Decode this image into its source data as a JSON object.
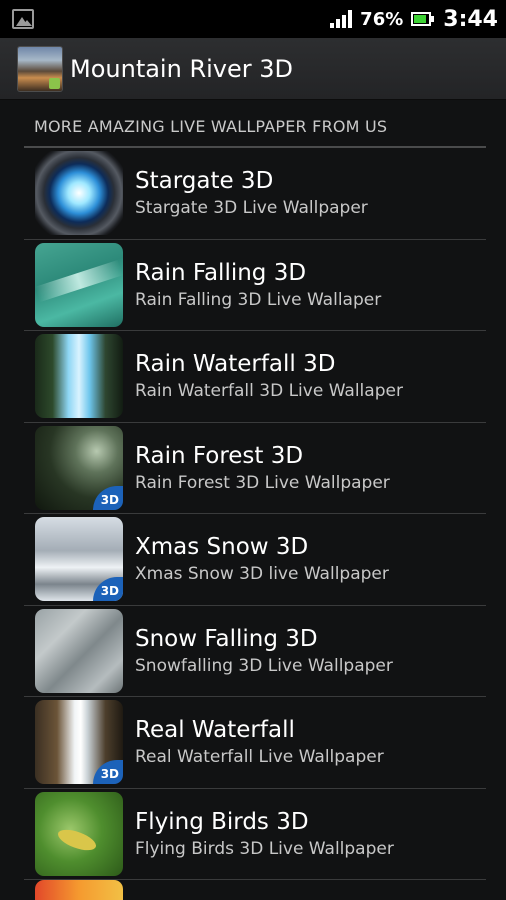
{
  "status_bar": {
    "battery_percent": "76%",
    "time": "3:44",
    "signal_bars": 4,
    "icons": [
      "gallery-icon",
      "signal-icon",
      "battery-icon"
    ]
  },
  "action_bar": {
    "title": "Mountain River 3D",
    "icon": "app-icon"
  },
  "section": {
    "header": "MORE AMAZING LIVE WALLPAPER FROM US"
  },
  "items": [
    {
      "title": "Stargate 3D",
      "subtitle": "Stargate 3D Live Wallpaper",
      "badge": ""
    },
    {
      "title": "Rain Falling 3D",
      "subtitle": "Rain Falling 3D Live Wallaper",
      "badge": ""
    },
    {
      "title": "Rain Waterfall 3D",
      "subtitle": "Rain Waterfall 3D Live Wallaper",
      "badge": ""
    },
    {
      "title": "Rain Forest 3D",
      "subtitle": "Rain Forest 3D Live Wallpaper",
      "badge": "3D"
    },
    {
      "title": "Xmas Snow 3D",
      "subtitle": "Xmas Snow 3D live Wallpaper",
      "badge": "3D"
    },
    {
      "title": "Snow Falling 3D",
      "subtitle": "Snowfalling 3D Live Wallpaper",
      "badge": ""
    },
    {
      "title": "Real Waterfall",
      "subtitle": "Real Waterfall Live Wallpaper",
      "badge": "3D"
    },
    {
      "title": "Flying Birds 3D",
      "subtitle": "Flying Birds 3D Live Wallpaper",
      "badge": ""
    }
  ],
  "colors": {
    "background": "#111213",
    "action_bar": "#2a2b2d",
    "battery_fill": "#3ed235",
    "badge": "#1c62b9"
  }
}
